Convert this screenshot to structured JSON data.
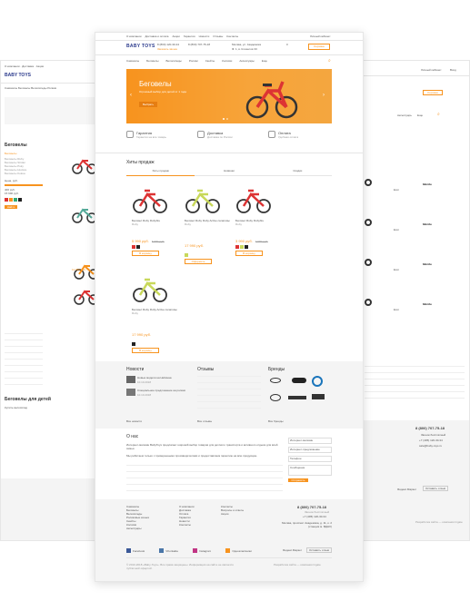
{
  "colors": {
    "accent": "#f7931e",
    "banner_end": "#f4a63f",
    "footer_bg": "#f4f4f4",
    "text": "#333333",
    "price": "#f7931e"
  },
  "header": {
    "topbar_left": [
      "О компании",
      "Доставка и оплата",
      "Акции",
      "Гарантия",
      "Новости",
      "Отзывы",
      "Контакты"
    ],
    "topbar_right": "Личный кабинет",
    "logo": "BABY TOYS",
    "phone1": "8 (800) 120-30-34",
    "phone2": "8 (800) 707-75-18",
    "callback": "Заказать звонок",
    "city": "Москва, ул. Академика",
    "address": "Ф. 1, в. Клиентов 33",
    "cart_count": "0",
    "cart_label": "Корзина"
  },
  "nav": {
    "items": [
      "Самокаты",
      "Беговелы",
      "Велосипеды",
      "Ролики",
      "Скейты",
      "Коляски",
      "Аксессуары",
      "Еще"
    ]
  },
  "banner": {
    "title": "Беговелы",
    "subtitle": "Огромный выбор для детей от 1 года",
    "button": "Выбрать"
  },
  "features": [
    {
      "icon": "shield-icon",
      "title": "Гарантия",
      "text": "Гарантия на все товары"
    },
    {
      "icon": "truck-icon",
      "title": "Доставка",
      "text": "Доставка по России"
    },
    {
      "icon": "card-icon",
      "title": "Оплата",
      "text": "Удобная оплата"
    }
  ],
  "hits": {
    "title": "Хиты продаж",
    "tabs": [
      "Хиты продаж",
      "Новинки",
      "Скидки"
    ],
    "products": [
      {
        "name": "Беговел Ruby Rubyfire",
        "brand": "Ruby",
        "price": "5 990 руб.",
        "old_price": "6 990 руб.",
        "button": "В корзину",
        "frame": "#d33",
        "swatches": [
          "#d33",
          "#222"
        ]
      },
      {
        "name": "Беговел Ruby Ruby Active салатовый",
        "brand": "Ruby",
        "price": "17 990 руб.",
        "old_price": "",
        "button": "Оформить",
        "frame": "#c8d85a",
        "swatches": [
          "#c8d85a"
        ]
      },
      {
        "name": "Беговел Ruby Rubyfire",
        "brand": "Ruby",
        "price": "3 990 руб.",
        "old_price": "4 990 руб.",
        "button": "В корзину",
        "frame": "#d33",
        "swatches": [
          "#d33",
          "#c8d85a",
          "#222"
        ]
      },
      {
        "name": "Беговел Ruby Ruby Active салатовый",
        "brand": "Ruby",
        "price": "17 990 руб.",
        "old_price": "",
        "button": "В корзину",
        "frame": "#c8d85a",
        "swatches": [
          "#222"
        ]
      }
    ]
  },
  "info": {
    "news_title": "Новости",
    "news": [
      {
        "title": "Новые модели на Hebavaa",
        "date": "10.10.2018"
      },
      {
        "title": "Специальное предложение на ролики",
        "date": "10.10.2018"
      }
    ],
    "news_all": "Все новости",
    "reviews_title": "Отзывы",
    "reviews_all": "Все отзывы",
    "brands_title": "Бренды",
    "brands_all": "Все бренды"
  },
  "about": {
    "title": "О нас",
    "para1": "Интернет-магазин BabyToys предлагает широкий выбор товаров для детского транспорта и активного отдыха для всей семьи.",
    "para2": "Мы работаем только с проверенными производителями и предоставляем гарантию на всю продукцию."
  },
  "form": {
    "fields": [
      "Интернет-магазин",
      "Интернет-предложение",
      "Телефон",
      "Сообщение"
    ],
    "button": "Отправить"
  },
  "footer": {
    "col1": [
      "Самокаты",
      "Беговелы",
      "Велосипеды",
      "Роликовые коньки",
      "Скейты",
      "Коляски",
      "Аксессуары"
    ],
    "col2": [
      "О компании",
      "Доставка",
      "Оплата",
      "Гарантия",
      "Новости",
      "Контакты"
    ],
    "col3": [
      "Контакты",
      "Вопросы и ответы",
      "Акции"
    ],
    "phone": "8 (800) 707-75-18",
    "phone_note": "Звонок бесплатный",
    "phone2": "+7 (495) 120-30-34",
    "address": "Москва, проспект Академика, д. 11, к. 2 (станция м. ВДНХ)",
    "social": [
      "Facebook",
      "VKontakte",
      "Instagram",
      "Одноклассники"
    ],
    "yandex": "Яндекс.Маркет",
    "feedback_btn": "Оставить отзыв",
    "copyright": "© 2010-2018 «Baby-Toys». Все права защищены. Информация на сайте не является публичной офертой.",
    "dev": "Разработка сайта — компания Ingate"
  },
  "left_page": {
    "logo": "BABY TOYS",
    "section": "Беговелы",
    "filter_title": "Беговелы",
    "filter_items": [
      "Беговелы Ruby",
      "Беговелы Strider",
      "Беговелы Puky",
      "Беговелы Hudora",
      "Беговелы Kokua"
    ],
    "price_label": "Цена, руб.",
    "price_from": "400 руб.",
    "price_to": "15 990 руб.",
    "button": "Найти",
    "product_price": "11 990 руб.",
    "footer_title": "Беговелы для детей",
    "footer_text": "Купить велосипед"
  },
  "right_page": {
    "links": [
      "Личный кабинет",
      "Вход"
    ],
    "cart": "Корзина",
    "nav_item": "Аксессуары",
    "nav_more": "Еще",
    "brand_labels": [
      "Ecoi",
      "Merida",
      "Ecoi",
      "Merida",
      "Ecoi",
      "Merida",
      "Ecoi",
      "Merida"
    ],
    "phone": "8 (800) 707-75-18",
    "phone_note": "Звонок бесплатный",
    "phone2": "+7 (495) 120-30-34",
    "email": "sale@baby-toys.ru",
    "yandex": "Яндекс.Маркет",
    "feedback_btn": "Оставить отзыв",
    "dev": "Разработка сайта — компания Ingate"
  }
}
